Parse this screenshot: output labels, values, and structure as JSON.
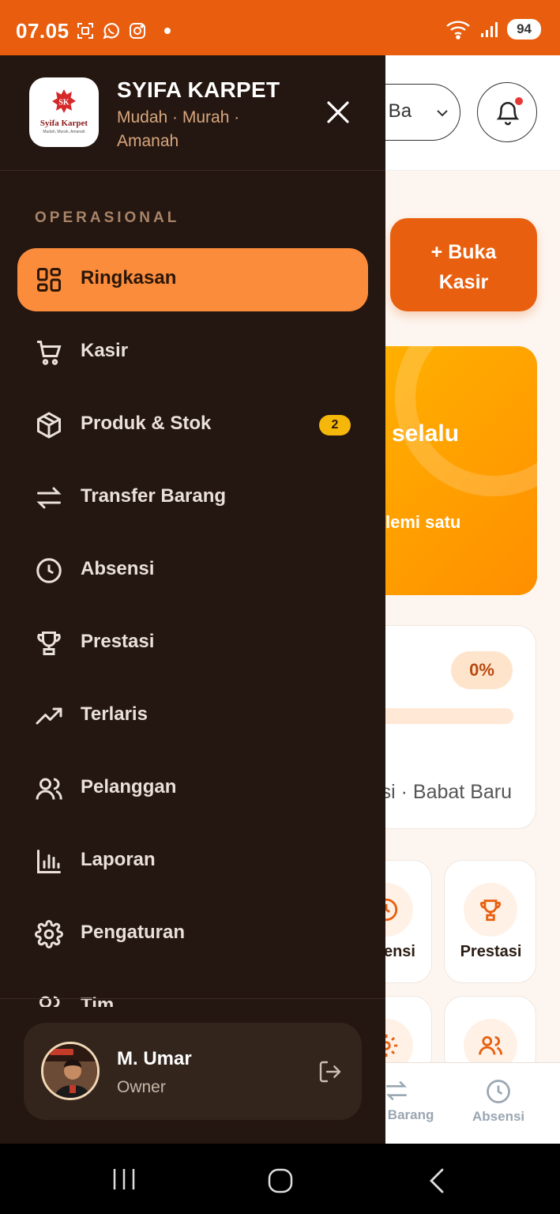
{
  "status_bar": {
    "time": "07.05",
    "battery": "94",
    "icons_left": [
      "screenshot-icon",
      "whatsapp-icon",
      "instagram-icon",
      "dot-icon"
    ],
    "icons_right": [
      "wifi-icon",
      "signal-icon",
      "battery-icon"
    ]
  },
  "drawer": {
    "store_name": "SYIFA KARPET",
    "tagline": "Mudah · Murah · Amanah",
    "logo": {
      "initials": "SK",
      "name": "Syifa Karpet",
      "tagline": "Mudah, Murah, Amanah"
    },
    "section_label": "OPERASIONAL",
    "menu": [
      {
        "label": "Ringkasan",
        "icon": "dashboard-grid-icon",
        "active": true
      },
      {
        "label": "Kasir",
        "icon": "shopping-cart-icon"
      },
      {
        "label": "Produk & Stok",
        "icon": "box-icon",
        "badge": "2"
      },
      {
        "label": "Transfer Barang",
        "icon": "transfer-arrows-icon"
      },
      {
        "label": "Absensi",
        "icon": "clock-icon"
      },
      {
        "label": "Prestasi",
        "icon": "trophy-icon"
      },
      {
        "label": "Terlaris",
        "icon": "trending-up-icon"
      },
      {
        "label": "Pelanggan",
        "icon": "users-icon"
      },
      {
        "label": "Laporan",
        "icon": "bar-chart-icon"
      },
      {
        "label": "Pengaturan",
        "icon": "gear-icon"
      },
      {
        "label": "Tim",
        "icon": "team-icon"
      }
    ],
    "profile": {
      "name": "M. Umar",
      "role": "Owner"
    }
  },
  "background": {
    "branch_select": "at Ba",
    "kasir_button": "+ Buka Kasir",
    "promo_title": "selalu",
    "promo_sub": "lemi satu",
    "progress": {
      "percent_label": "0%",
      "value": 0
    },
    "card_footer": "si · Babat Baru",
    "tiles": [
      "ensi",
      "Prestasi"
    ],
    "bottom_nav": [
      "er Barang",
      "Absensi"
    ]
  },
  "colors": {
    "status_bar": "#e85d0e",
    "drawer_bg": "#241610",
    "active_item": "#fb8c3c",
    "badge": "#f5b70a",
    "accent": "#e8600f"
  }
}
